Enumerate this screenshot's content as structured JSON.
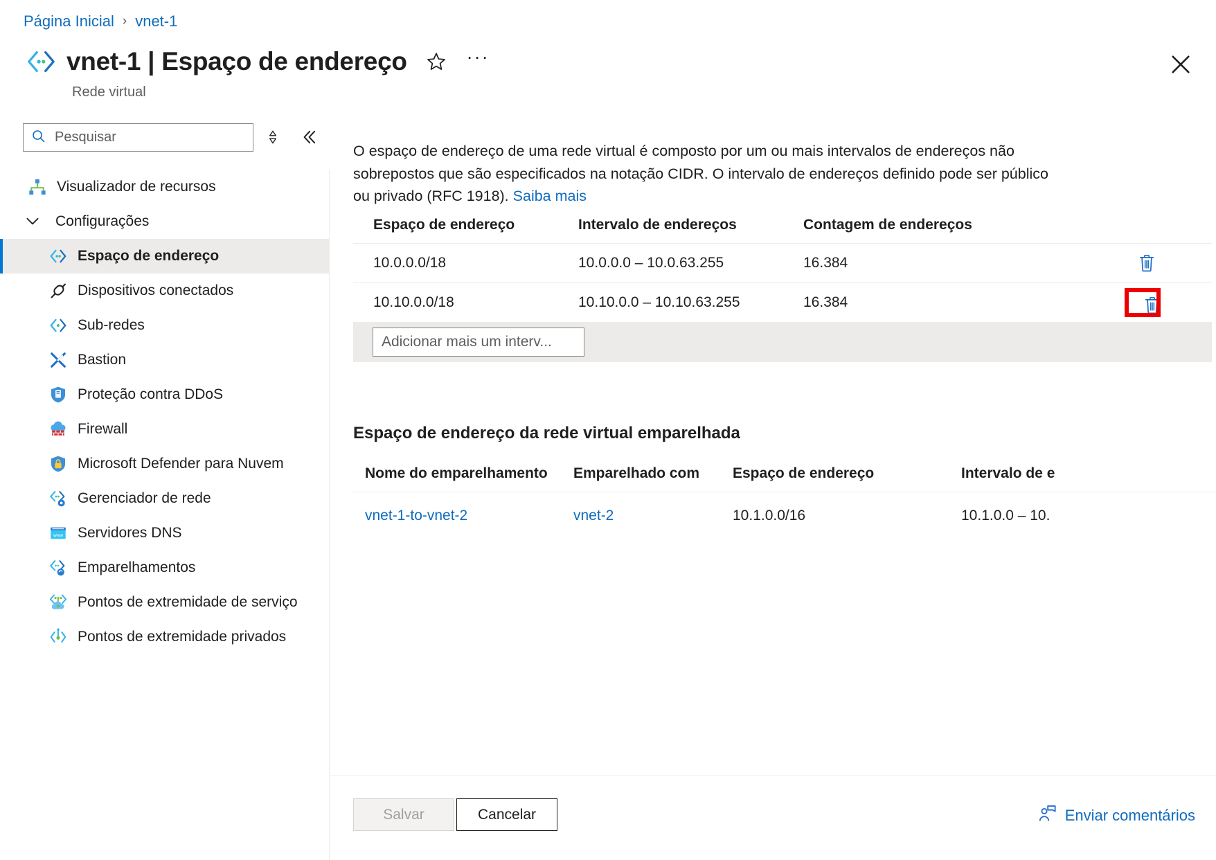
{
  "breadcrumb": {
    "home": "Página Inicial",
    "separator": "›",
    "current": "vnet-1"
  },
  "header": {
    "title": "vnet-1 | Espaço de endereço",
    "subtitle": "Rede virtual",
    "favorite_label": "☆",
    "more_label": "···",
    "close_label": "✕"
  },
  "search": {
    "placeholder": "Pesquisar",
    "value": ""
  },
  "sidebar": {
    "items": [
      {
        "label": "Visualizador de recursos",
        "icon": "resource-visualizer-icon",
        "type": "item",
        "selected": false
      },
      {
        "label": "Configurações",
        "icon": "chevron-down-icon",
        "type": "group",
        "selected": false
      },
      {
        "label": "Espaço de endereço",
        "icon": "address-space-icon",
        "type": "child",
        "selected": true
      },
      {
        "label": "Dispositivos conectados",
        "icon": "connected-devices-icon",
        "type": "child",
        "selected": false
      },
      {
        "label": "Sub-redes",
        "icon": "subnets-icon",
        "type": "child",
        "selected": false
      },
      {
        "label": "Bastion",
        "icon": "bastion-icon",
        "type": "child",
        "selected": false
      },
      {
        "label": "Proteção contra DDoS",
        "icon": "ddos-protection-icon",
        "type": "child",
        "selected": false
      },
      {
        "label": "Firewall",
        "icon": "firewall-icon",
        "type": "child",
        "selected": false
      },
      {
        "label": "Microsoft Defender para Nuvem",
        "icon": "defender-cloud-icon",
        "type": "child",
        "selected": false
      },
      {
        "label": "Gerenciador de rede",
        "icon": "network-manager-icon",
        "type": "child",
        "selected": false
      },
      {
        "label": "Servidores DNS",
        "icon": "dns-servers-icon",
        "type": "child",
        "selected": false
      },
      {
        "label": "Emparelhamentos",
        "icon": "peerings-icon",
        "type": "child",
        "selected": false
      },
      {
        "label": "Pontos de extremidade de serviço",
        "icon": "service-endpoints-icon",
        "type": "child",
        "selected": false
      },
      {
        "label": "Pontos de extremidade privados",
        "icon": "private-endpoints-icon",
        "type": "child",
        "selected": false
      }
    ]
  },
  "main": {
    "description_text": "O espaço de endereço de uma rede virtual é composto por um ou mais intervalos de endereços não sobrepostos que são especificados na notação CIDR. O intervalo de endereços definido pode ser público ou privado (RFC 1918). ",
    "description_link": "Saiba mais",
    "address_table": {
      "headers": [
        "Espaço de endereço",
        "Intervalo de endereços",
        "Contagem de endereços",
        ""
      ],
      "rows": [
        {
          "address_space": "10.0.0.0/18",
          "address_range": "10.0.0.0 – 10.0.63.255",
          "address_count": "16.384",
          "delete_icon": "trash-icon",
          "highlighted": false
        },
        {
          "address_space": "10.10.0.0/18",
          "address_range": "10.10.0.0 – 10.10.63.255",
          "address_count": "16.384",
          "delete_icon": "trash-icon",
          "highlighted": true
        }
      ],
      "add_placeholder": "Adicionar mais um interv..."
    },
    "peered_section": {
      "title": "Espaço de endereço da rede virtual emparelhada",
      "headers": [
        "Nome do emparelhamento",
        "Emparelhado com",
        "Espaço de endereço",
        "Intervalo de e"
      ],
      "rows": [
        {
          "peering_name": "vnet-1-to-vnet-2",
          "peered_with": "vnet-2",
          "address_space": "10.1.0.0/16",
          "address_range": "10.1.0.0 – 10."
        }
      ]
    }
  },
  "footer": {
    "save_label": "Salvar",
    "cancel_label": "Cancelar",
    "feedback_label": "Enviar comentários"
  },
  "colors": {
    "accent": "#0078d4",
    "link": "#0f6cbd",
    "highlight": "#ee0000",
    "selected_bg": "#edebe9"
  }
}
